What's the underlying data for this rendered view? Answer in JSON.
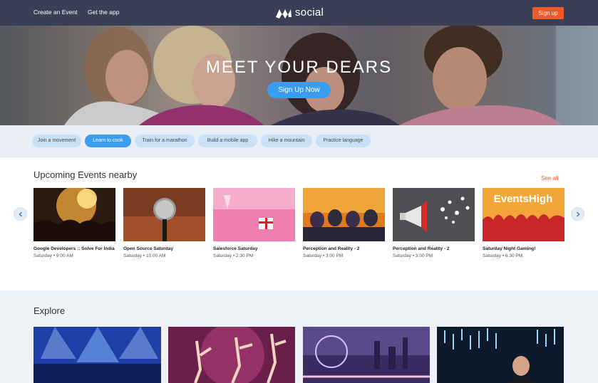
{
  "header": {
    "nav": [
      "Create an Event",
      "Get the app"
    ],
    "logo_text": "social",
    "signup_label": "Sign up"
  },
  "hero": {
    "title": "MEET YOUR DEARS",
    "cta": "Sign Up Now"
  },
  "chips": [
    {
      "label": "Join a movement",
      "active": false
    },
    {
      "label": "Learn to cook",
      "active": true
    },
    {
      "label": "Train for a marathon",
      "active": false
    },
    {
      "label": "Build a mobile app",
      "active": false
    },
    {
      "label": "Hike a mountain",
      "active": false
    },
    {
      "label": "Practice language",
      "active": false
    }
  ],
  "upcoming": {
    "title": "Upcoming Events nearby",
    "see_all": "See all",
    "events": [
      {
        "title": "Google Developers :: Solve For India",
        "day": "Saturday",
        "time": "9:00 AM"
      },
      {
        "title": "Open Source Saturday",
        "day": "Saturday",
        "time": "10:00 AM"
      },
      {
        "title": "Salesforce Saturday",
        "day": "Saturday",
        "time": "2:30 PM"
      },
      {
        "title": "Perception and Reality - 2",
        "day": "Saturday",
        "time": "3:00 PM"
      },
      {
        "title": "Perception and Reality - 2",
        "day": "Saturday",
        "time": "3:00 PM"
      },
      {
        "title": "Saturday Night Gaming!",
        "day": "Saturday",
        "time": "6:30 PM"
      }
    ],
    "events_high_logo": "EventsHigh"
  },
  "explore": {
    "title": "Explore"
  },
  "colors": {
    "accent": "#f05a28",
    "primary": "#3b9df0",
    "header_bg": "#3a3f55"
  }
}
